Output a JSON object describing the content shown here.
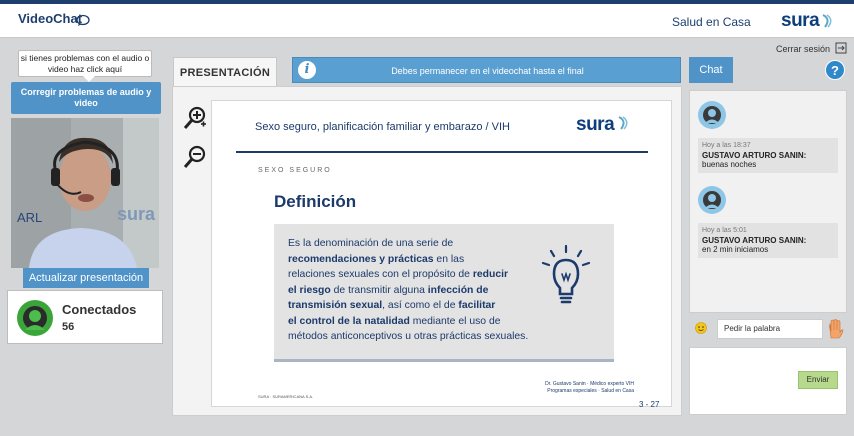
{
  "header": {
    "app_name": "VideoChat",
    "section": "Salud en Casa",
    "brand": "sura",
    "accent_color": "#1e3f6e"
  },
  "left": {
    "help_text": "si tienes problemas con el audio o video haz click aquí",
    "fix_button": "Corregir problemas de audio y video",
    "video_overlay_left": "ARL",
    "video_overlay_right": "sura",
    "refresh_button": "Actualizar presentación",
    "connected_label": "Conectados",
    "connected_count": "56"
  },
  "presentation": {
    "tab_label": "PRESENTACIÓN",
    "info_message": "Debes permanecer en el videochat hasta el final",
    "icons": [
      "zoom-in-icon",
      "zoom-out-icon"
    ],
    "slide": {
      "title": "Sexo seguro, planificación familiar y embarazo / VIH",
      "brand": "sura",
      "section": "SEXO SEGURO",
      "heading": "Definición",
      "definition": {
        "p1": "Es la denominación de una serie de",
        "p2": "recomendaciones y prácticas",
        "p3": " en las",
        "p4": "relaciones sexuales con el propósito de ",
        "p5": "reducir",
        "p6": "el riesgo",
        "p7": " de transmitir alguna ",
        "p8": "infección de",
        "p9": "transmisión sexual",
        "p10": ", así como el de ",
        "p11": "facilitar",
        "p12": "el control de la natalidad",
        "p13": " mediante el uso de",
        "p14": "métodos anticonceptivos u otras prácticas sexuales."
      },
      "footer_left": "SURA · SURAMERICANA S.A.",
      "footer_right_1": "Dr. Gustavo Sanin · Médico experto VIH",
      "footer_right_2": "Programas especiales · Salud en Casa"
    },
    "page_indicator": "3 - 27"
  },
  "right": {
    "logout_label": "Cerrar sesión",
    "chat_tab": "Chat",
    "help_symbol": "?",
    "messages": [
      {
        "time": "Hoy a las 18:37",
        "author": "GUSTAVO ARTURO SANIN:",
        "text": "buenas noches"
      },
      {
        "time": "Hoy a las 5:01",
        "author": "GUSTAVO ARTURO SANIN:",
        "text": "en 2 min iniciamos"
      }
    ],
    "ask_word_label": "Pedir la palabra",
    "send_button": "Enviar"
  }
}
